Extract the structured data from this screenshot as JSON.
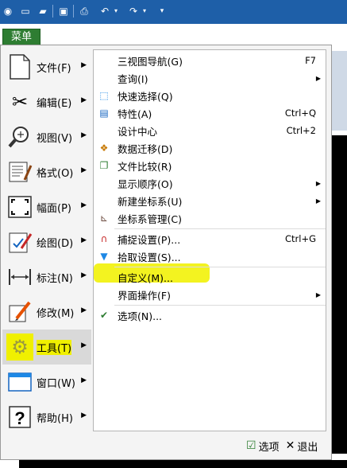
{
  "toolbar": {
    "icons": [
      "app-logo-icon",
      "new-file-icon",
      "open-folder-icon",
      "save-icon",
      "print-icon",
      "undo-icon",
      "redo-icon",
      "customize-icon"
    ]
  },
  "menu_tab": {
    "label": "菜单"
  },
  "categories": [
    {
      "label": "文件(F)"
    },
    {
      "label": "编辑(E)"
    },
    {
      "label": "视图(V)"
    },
    {
      "label": "格式(O)"
    },
    {
      "label": "幅面(P)"
    },
    {
      "label": "绘图(D)"
    },
    {
      "label": "标注(N)"
    },
    {
      "label": "修改(M)"
    },
    {
      "label": "工具(T)"
    },
    {
      "label": "窗口(W)"
    },
    {
      "label": "帮助(H)"
    }
  ],
  "submenu": {
    "items": [
      {
        "label": "三视图导航(G)",
        "shortcut": "F7"
      },
      {
        "label": "查询(I)"
      },
      {
        "label": "快速选择(Q)"
      },
      {
        "label": "特性(A)",
        "shortcut": "Ctrl+Q"
      },
      {
        "label": "设计中心",
        "shortcut": "Ctrl+2"
      },
      {
        "label": "数据迁移(D)"
      },
      {
        "label": "文件比较(R)"
      },
      {
        "label": "显示顺序(O)"
      },
      {
        "label": "新建坐标系(U)"
      },
      {
        "label": "坐标系管理(C)"
      },
      {
        "label": "捕捉设置(P)...",
        "shortcut": "Ctrl+G"
      },
      {
        "label": "拾取设置(S)..."
      },
      {
        "label": "自定义(M)..."
      },
      {
        "label": "界面操作(F)"
      },
      {
        "label": "选项(N)..."
      }
    ]
  },
  "footer": {
    "options_label": "选项",
    "exit_label": "退出"
  },
  "colors": {
    "highlight": "#f0f000",
    "menu_tab": "#2e7d32",
    "topbar": "#1e5fa8"
  }
}
